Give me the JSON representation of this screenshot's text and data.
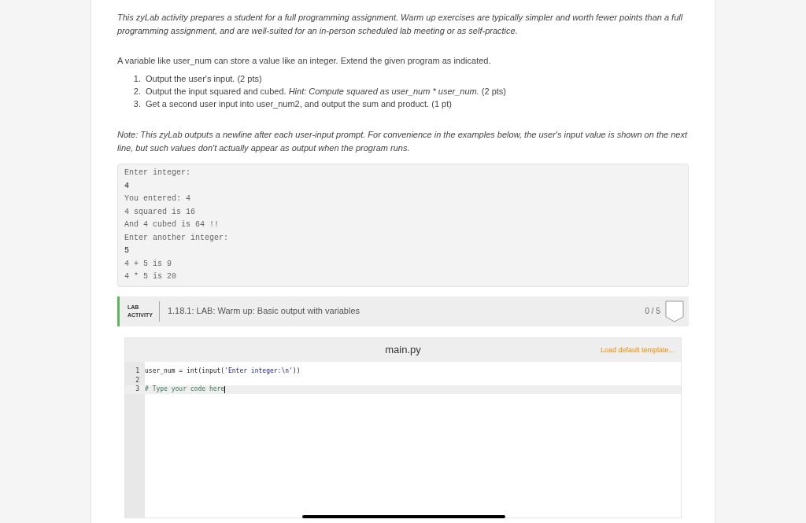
{
  "intro": "This zyLab activity prepares a student for a full programming assignment. Warm up exercises are typically simpler and worth fewer points than a full programming assignment, and are well-suited for an in-person scheduled lab meeting or as self-practice.",
  "description": "A variable like user_num can store a value like an integer. Extend the given program as indicated.",
  "steps": [
    {
      "number": "1.",
      "parts": [
        {
          "text": "Output the user's input. (2 pts)",
          "italic": false
        }
      ]
    },
    {
      "number": "2.",
      "parts": [
        {
          "text": "Output the input squared and cubed. ",
          "italic": false
        },
        {
          "text": "Hint: Compute squared as user_num * user_num.",
          "italic": true
        },
        {
          "text": " (2 pts)",
          "italic": false
        }
      ]
    },
    {
      "number": "3.",
      "parts": [
        {
          "text": "Get a second user input into user_num2, and output the sum and product. (1 pt)",
          "italic": false
        }
      ]
    }
  ],
  "note": "Note: This zyLab outputs a newline after each user-input prompt. For convenience in the examples below, the user's input value is shown on the next line, but such values don't actually appear as output when the program runs.",
  "sample_output": [
    {
      "text": "Enter integer:",
      "kind": "output"
    },
    {
      "text": "4",
      "kind": "input"
    },
    {
      "text": "You entered: 4",
      "kind": "output"
    },
    {
      "text": "4 squared is 16",
      "kind": "output"
    },
    {
      "text": "And 4 cubed is 64 !!",
      "kind": "output"
    },
    {
      "text": "Enter another integer:",
      "kind": "output"
    },
    {
      "text": "5",
      "kind": "input"
    },
    {
      "text": "4 + 5 is 9",
      "kind": "output"
    },
    {
      "text": "4 * 5 is 20",
      "kind": "output"
    }
  ],
  "lab": {
    "label_line_1": "LAB",
    "label_line_2": "ACTIVITY",
    "title": "1.18.1: LAB: Warm up: Basic output with variables",
    "score": "0 / 5"
  },
  "editor": {
    "filename": "main.py",
    "load_link": "Load default template...",
    "lines": [
      {
        "number": "1",
        "current": false,
        "tokens": [
          {
            "text": "user_num = int(input(",
            "kind": "plain"
          },
          {
            "text": "'Enter integer:\\n'",
            "kind": "string"
          },
          {
            "text": "))",
            "kind": "plain"
          }
        ]
      },
      {
        "number": "2",
        "current": false
      },
      {
        "number": "3",
        "current": true,
        "tokens": [
          {
            "text": "# Type your code here",
            "kind": "comment"
          }
        ]
      }
    ]
  }
}
